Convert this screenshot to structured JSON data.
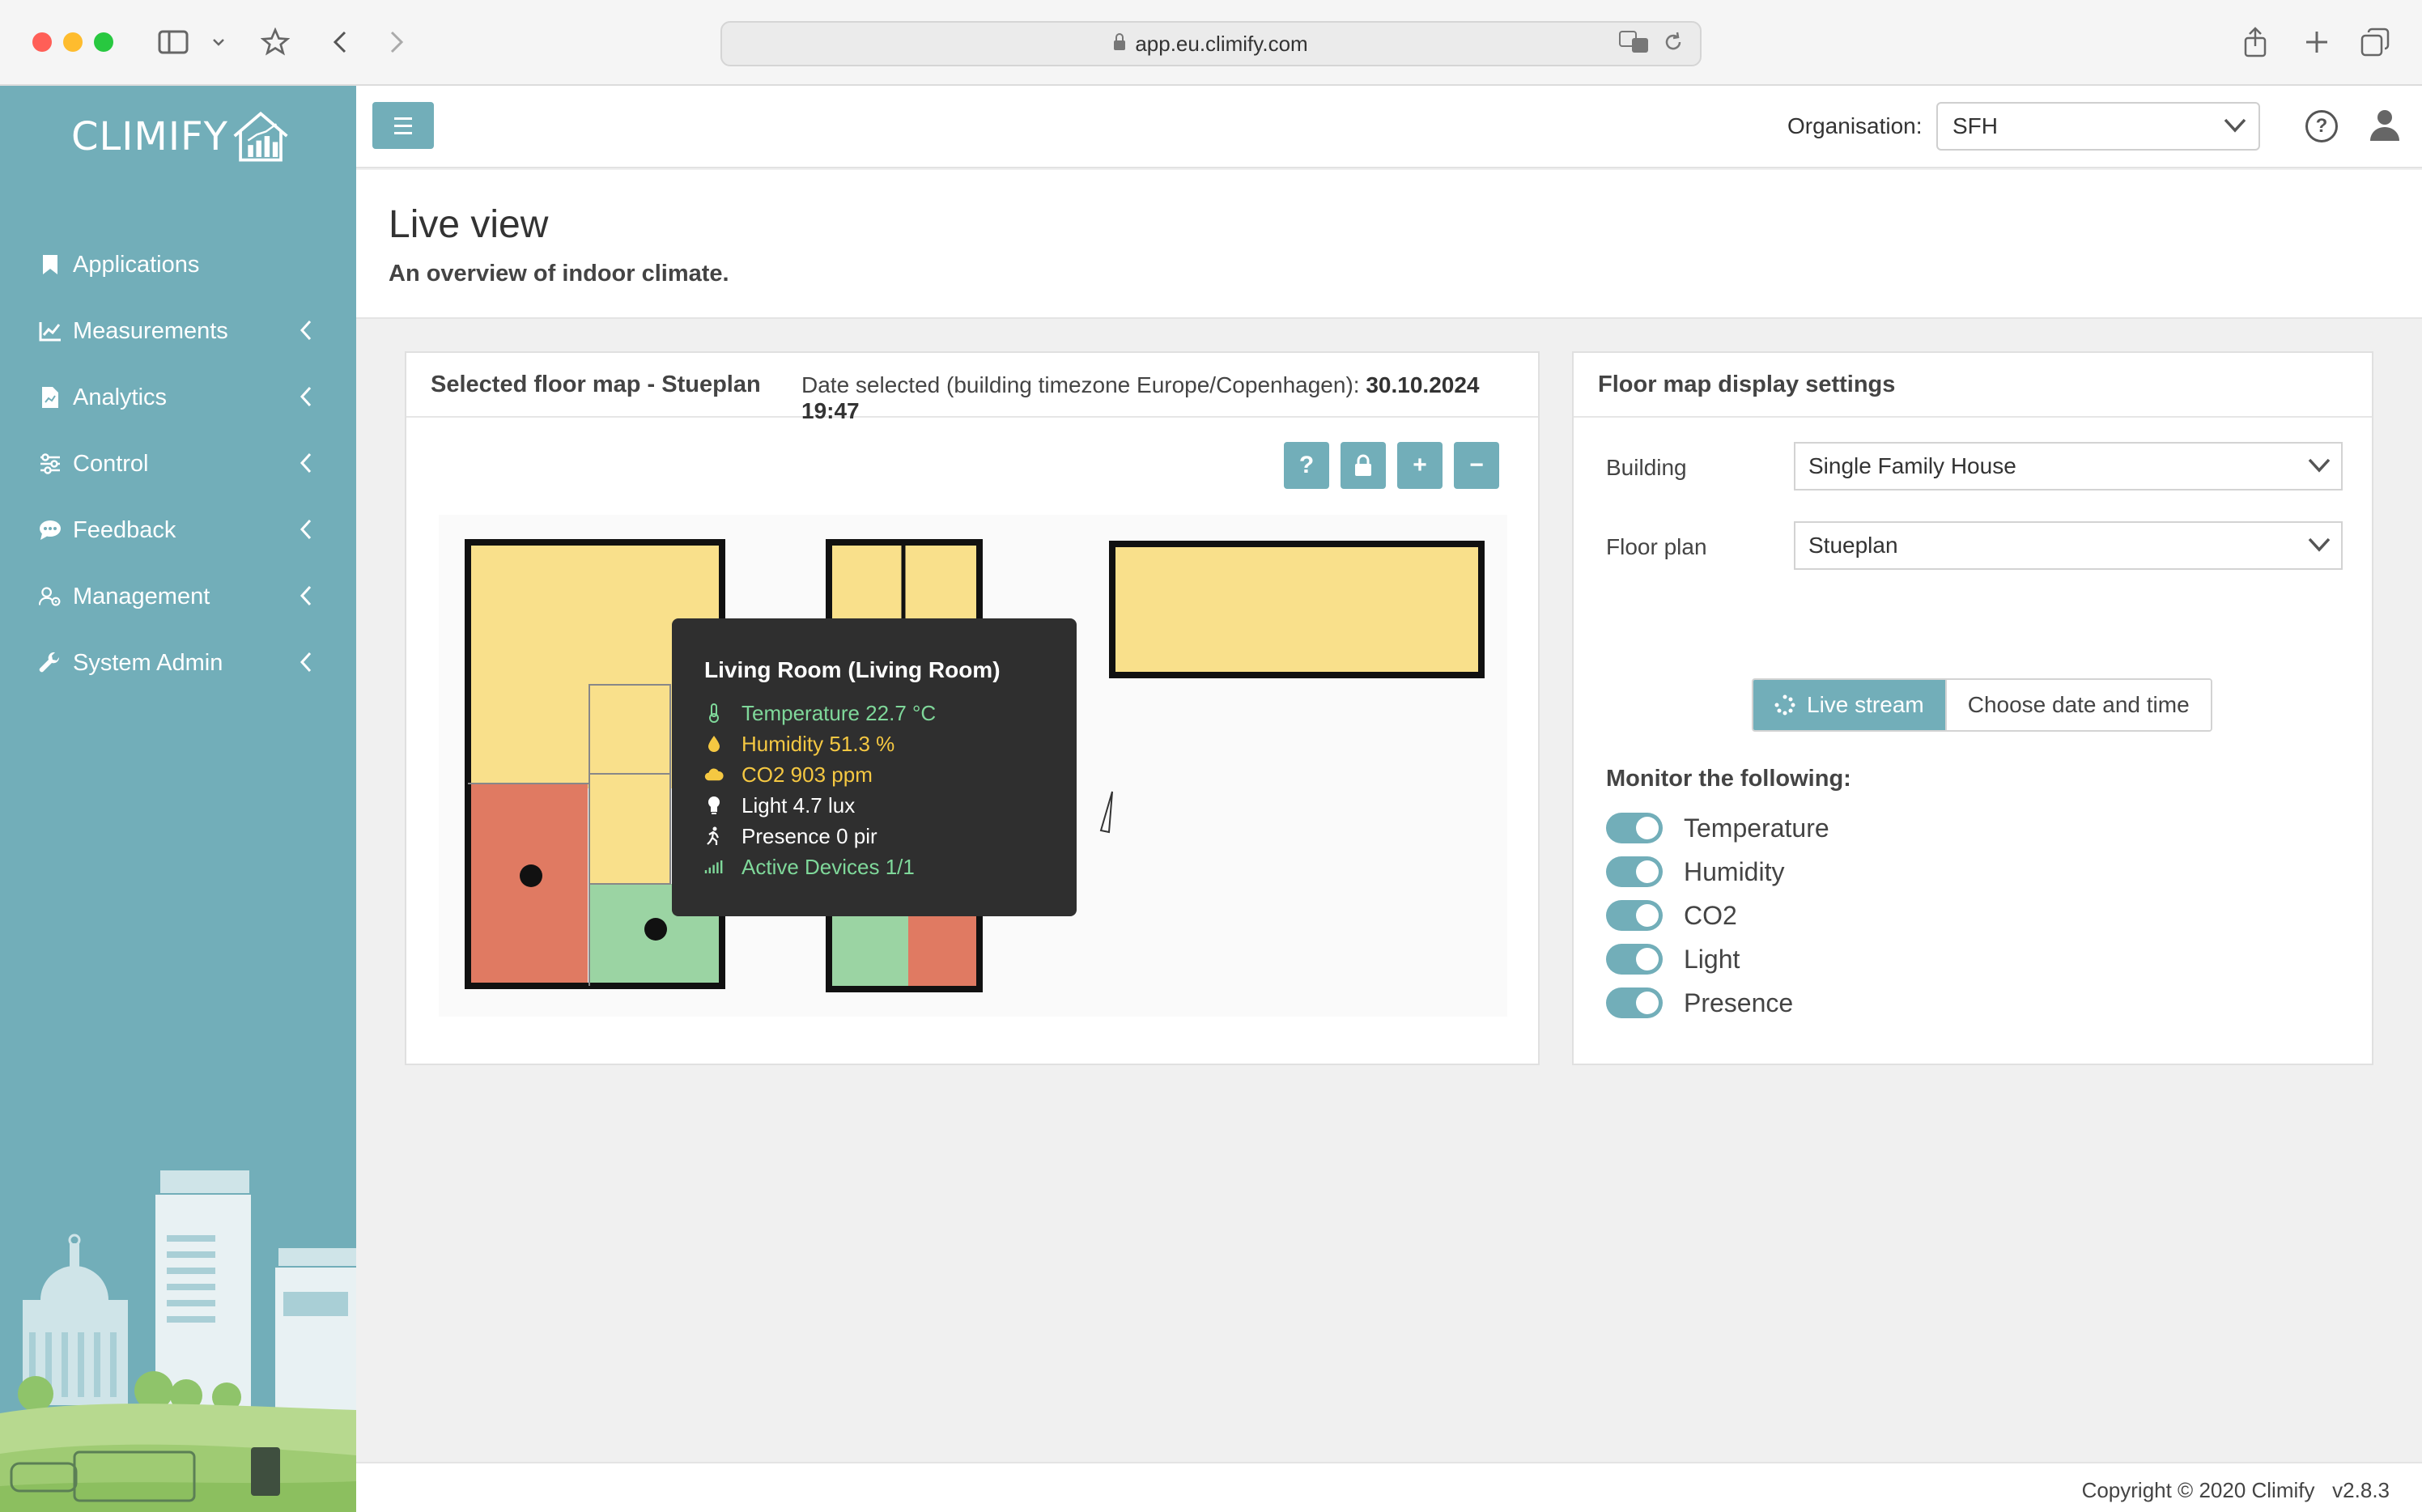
{
  "browser": {
    "url": "app.eu.climify.com"
  },
  "sidebar": {
    "logo_text": "CLIMIFY",
    "items": [
      {
        "label": "Applications",
        "icon": "bookmark-icon"
      },
      {
        "label": "Measurements",
        "icon": "line-chart-icon"
      },
      {
        "label": "Analytics",
        "icon": "report-icon"
      },
      {
        "label": "Control",
        "icon": "sliders-icon"
      },
      {
        "label": "Feedback",
        "icon": "chat-icon"
      },
      {
        "label": "Management",
        "icon": "user-gear-icon"
      },
      {
        "label": "System Admin",
        "icon": "wrench-icon"
      }
    ]
  },
  "topbar": {
    "org_label": "Organisation:",
    "org_value": "SFH"
  },
  "page": {
    "title": "Live view",
    "subtitle": "An overview of indoor climate."
  },
  "floor_card": {
    "title": "Selected floor map - Stueplan",
    "date_label": "Date selected (building timezone Europe/Copenhagen): ",
    "date_value": "30.10.2024 19:47",
    "tools": [
      "?",
      "+",
      "−"
    ]
  },
  "tooltip": {
    "title": "Living Room (Living Room)",
    "rows": [
      {
        "text": "Temperature 22.7 °C",
        "color": "#7fd89a"
      },
      {
        "text": "Humidity 51.3 %",
        "color": "#f5c842"
      },
      {
        "text": "CO2 903 ppm",
        "color": "#f5c842"
      },
      {
        "text": "Light 4.7 lux",
        "color": "#ffffff"
      },
      {
        "text": "Presence 0 pir",
        "color": "#ffffff"
      },
      {
        "text": "Active Devices 1/1",
        "color": "#7fd89a"
      }
    ]
  },
  "settings": {
    "title": "Floor map display settings",
    "building_label": "Building",
    "building_value": "Single Family House",
    "floorplan_label": "Floor plan",
    "floorplan_value": "Stueplan",
    "live_stream": "Live stream",
    "choose_date": "Choose date and time",
    "monitor_title": "Monitor the following:",
    "toggles": [
      "Temperature",
      "Humidity",
      "CO2",
      "Light",
      "Presence"
    ]
  },
  "footer": {
    "copyright": "Copyright © 2020 Climify",
    "version": "v2.8.3"
  },
  "colors": {
    "accent": "#72aeb9",
    "room_yellow": "#f9e08b",
    "room_red": "#e07a62",
    "room_green": "#9bd4a3"
  }
}
